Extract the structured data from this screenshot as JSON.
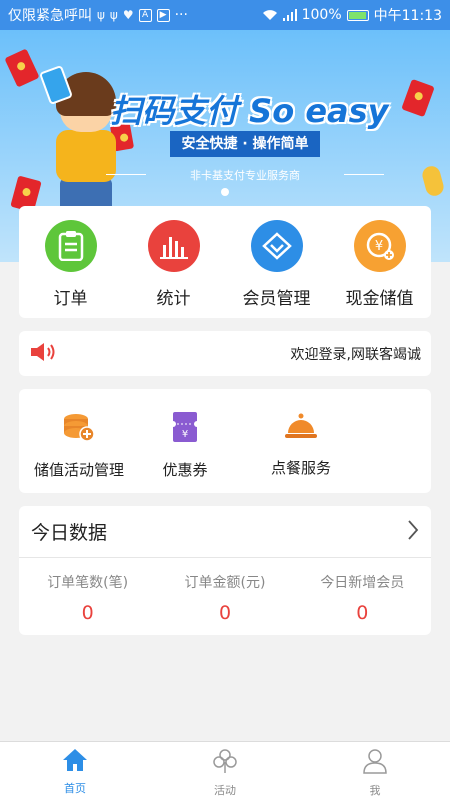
{
  "status_bar": {
    "carrier": "仅限紧急呼叫",
    "icons": [
      "usb-icon",
      "usb-icon",
      "heart-icon",
      "a-icon",
      "play-icon",
      "more-icon"
    ],
    "more": "···",
    "battery": "100%",
    "time": "中午11:13"
  },
  "banner": {
    "title": "扫码支付 So easy",
    "ribbon": "安全快捷 · 操作简单",
    "subtitle": "非卡基支付专业服务商"
  },
  "quick_actions": [
    {
      "label": "订单",
      "icon": "clipboard-icon",
      "color": "#5ec63a"
    },
    {
      "label": "统计",
      "icon": "bar-chart-icon",
      "color": "#e9423d"
    },
    {
      "label": "会员管理",
      "icon": "diamond-icon",
      "color": "#2d8ee6"
    },
    {
      "label": "现金储值",
      "icon": "yuan-coin-icon",
      "color": "#f7a132"
    }
  ],
  "notice": {
    "icon": "speaker-icon",
    "text": "欢迎登录,网联客竭诚"
  },
  "services": [
    {
      "label": "储值活动管理",
      "icon": "coin-stack-icon"
    },
    {
      "label": "优惠券",
      "icon": "coupon-icon"
    },
    {
      "label": "点餐服务",
      "icon": "food-cloche-icon"
    }
  ],
  "today_data": {
    "title": "今日数据",
    "stats": [
      {
        "label": "订单笔数(笔)",
        "value": "0"
      },
      {
        "label": "订单金额(元)",
        "value": "0"
      },
      {
        "label": "今日新增会员",
        "value": "0"
      }
    ]
  },
  "tab_bar": {
    "tabs": [
      {
        "label": "首页",
        "icon": "home-icon",
        "active": true
      },
      {
        "label": "活动",
        "icon": "clover-icon",
        "active": false
      },
      {
        "label": "我",
        "icon": "user-icon",
        "active": false
      }
    ]
  },
  "colors": {
    "primary": "#2d8ee6",
    "status_bar": "#3d8fe8",
    "stat_value": "#e9423d"
  }
}
